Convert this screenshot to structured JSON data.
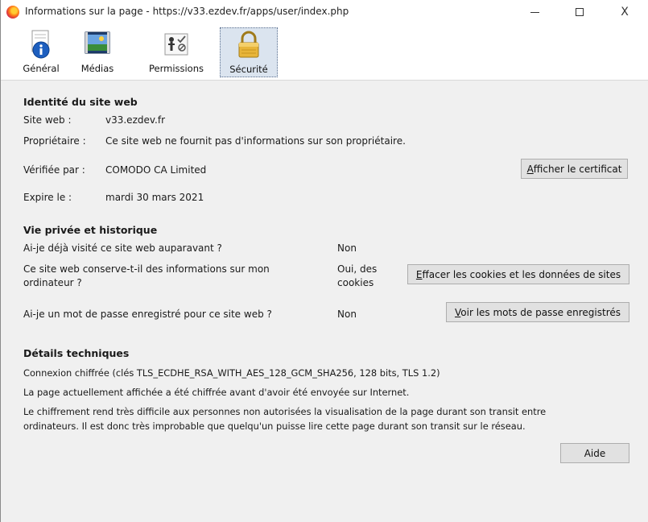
{
  "window": {
    "title": "Informations sur la page - https://v33.ezdev.fr/apps/user/index.php",
    "controls": {
      "minimize": "—",
      "maximize": "□",
      "close": "X"
    }
  },
  "tabs": [
    {
      "label": "Général",
      "icon": "info-icon",
      "selected": false
    },
    {
      "label": "Médias",
      "icon": "media-icon",
      "selected": false
    },
    {
      "label": "Permissions",
      "icon": "permissions-icon",
      "selected": false
    },
    {
      "label": "Sécurité",
      "icon": "padlock-icon",
      "selected": true
    }
  ],
  "identity": {
    "heading": "Identité du site web",
    "site_label": "Site web :",
    "site_value": "v33.ezdev.fr",
    "owner_label": "Propriétaire :",
    "owner_value": "Ce site web ne fournit pas d'informations sur son propriétaire.",
    "verified_label": "Vérifiée par :",
    "verified_value": "COMODO CA Limited",
    "expires_label": "Expire le :",
    "expires_value": "mardi 30 mars 2021",
    "cert_button": "Afficher le certificat"
  },
  "privacy": {
    "heading": "Vie privée et historique",
    "q1": "Ai-je déjà visité ce site web auparavant ?",
    "a1": "Non",
    "q2_line1": "Ce site web conserve-t-il des informations sur mon",
    "q2_line2": "ordinateur ?",
    "a2_line1": "Oui, des",
    "a2_line2": "cookies",
    "clear_button": "Effacer les cookies et les données de sites",
    "q3": "Ai-je un mot de passe enregistré pour ce site web ?",
    "a3": "Non",
    "passwords_button": "Voir les mots de passe enregistrés"
  },
  "technical": {
    "heading": "Détails techniques",
    "line1": "Connexion chiffrée (clés TLS_ECDHE_RSA_WITH_AES_128_GCM_SHA256, 128 bits, TLS 1.2)",
    "line2": "La page actuellement affichée a été chiffrée avant d'avoir été envoyée sur Internet.",
    "line3": "Le chiffrement rend très difficile aux personnes non autorisées la visualisation de la page durant son transit entre",
    "line4": "ordinateurs. Il est donc très improbable que quelqu'un puisse lire cette page durant son transit sur le réseau.",
    "help_button": "Aide"
  }
}
